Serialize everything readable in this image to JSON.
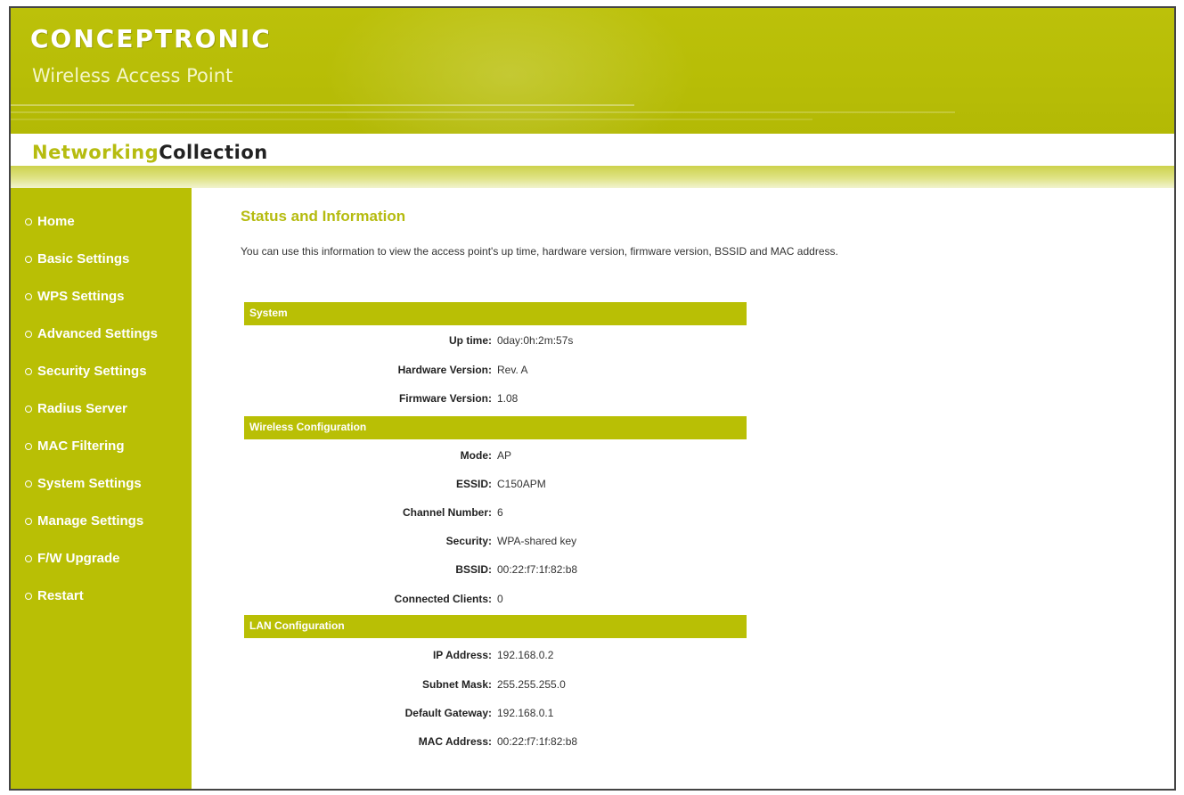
{
  "header": {
    "brand": "CONCEPTRONIC",
    "product": "Wireless Access Point",
    "collection_part1": "Networking",
    "collection_part2": "Collection"
  },
  "theme": {
    "accent": "#b9bf05",
    "title_color": "#b5bb0f"
  },
  "sidebar": {
    "items": [
      {
        "label": "Home"
      },
      {
        "label": "Basic Settings"
      },
      {
        "label": "WPS Settings"
      },
      {
        "label": "Advanced Settings"
      },
      {
        "label": "Security Settings"
      },
      {
        "label": "Radius Server"
      },
      {
        "label": "MAC Filtering"
      },
      {
        "label": "System Settings"
      },
      {
        "label": "Manage Settings"
      },
      {
        "label": "F/W Upgrade"
      },
      {
        "label": "Restart"
      }
    ]
  },
  "main": {
    "title": "Status and Information",
    "description": "You can use this information to view the access point's up time, hardware version, firmware version, BSSID and MAC address.",
    "sections": [
      {
        "header": "System",
        "rows": [
          {
            "label": "Up time:",
            "value": "0day:0h:2m:57s"
          },
          {
            "label": "Hardware Version:",
            "value": "Rev. A"
          },
          {
            "label": "Firmware Version:",
            "value": "1.08"
          }
        ]
      },
      {
        "header": "Wireless Configuration",
        "rows": [
          {
            "label": "Mode:",
            "value": "AP"
          },
          {
            "label": "ESSID:",
            "value": "C150APM"
          },
          {
            "label": "Channel Number:",
            "value": "6"
          },
          {
            "label": "Security:",
            "value": "WPA-shared key"
          },
          {
            "label": "BSSID:",
            "value": "00:22:f7:1f:82:b8"
          },
          {
            "label": "Connected Clients:",
            "value": "0"
          }
        ]
      },
      {
        "header": "LAN Configuration",
        "rows": [
          {
            "label": "IP Address:",
            "value": "192.168.0.2"
          },
          {
            "label": "Subnet Mask:",
            "value": "255.255.255.0"
          },
          {
            "label": "Default Gateway:",
            "value": "192.168.0.1"
          },
          {
            "label": "MAC Address:",
            "value": "00:22:f7:1f:82:b8"
          }
        ]
      }
    ]
  }
}
